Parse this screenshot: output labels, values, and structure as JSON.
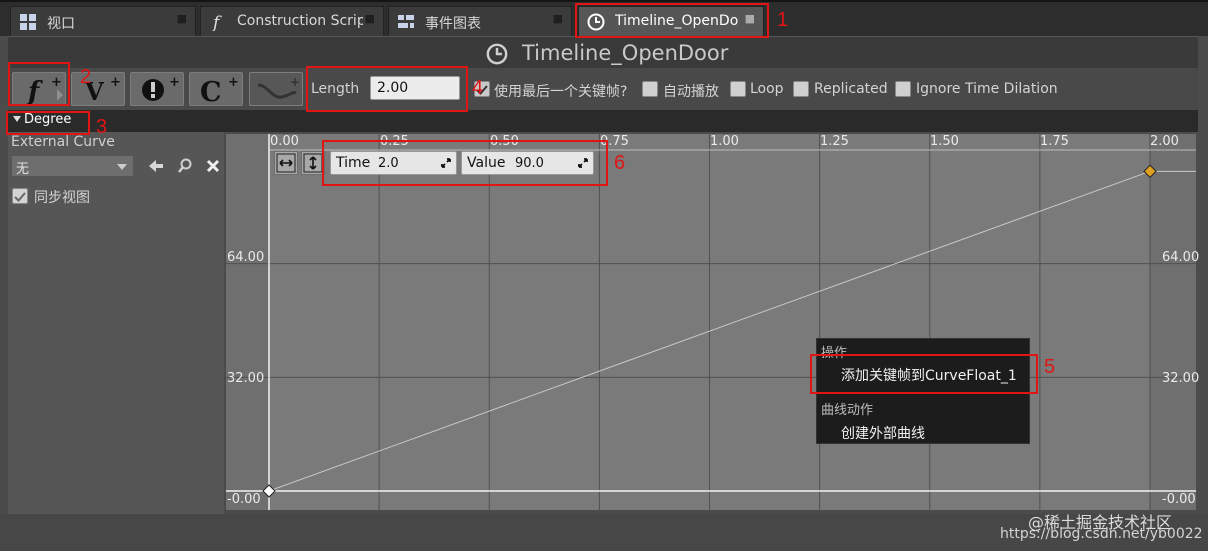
{
  "tabs": [
    {
      "label": "视口",
      "icon": "viewport-grid-icon",
      "active": false
    },
    {
      "label": "Construction Script",
      "icon": "function-icon",
      "active": false
    },
    {
      "label": "事件图表",
      "icon": "event-graph-icon",
      "active": false
    },
    {
      "label": "Timeline_OpenDoor",
      "icon": "clock-icon",
      "active": true
    }
  ],
  "title": "Timeline_OpenDoor",
  "toolbar": {
    "buttons": [
      {
        "name": "add-float-track-button",
        "icon": "float-track-icon"
      },
      {
        "name": "add-vector-track-button",
        "icon": "vector-track-icon"
      },
      {
        "name": "add-event-track-button",
        "icon": "event-track-icon"
      },
      {
        "name": "add-color-track-button",
        "icon": "color-track-icon"
      },
      {
        "name": "add-curve-asset-button",
        "icon": "curve-asset-icon"
      }
    ],
    "length_label": "Length",
    "length_value": "2.00",
    "options": [
      {
        "label": "使用最后一个关键帧?",
        "checked": true
      },
      {
        "label": "自动播放",
        "checked": false
      },
      {
        "label": "Loop",
        "checked": false
      },
      {
        "label": "Replicated",
        "checked": false
      },
      {
        "label": "Ignore Time Dilation",
        "checked": false
      }
    ]
  },
  "track": {
    "name": "Degree",
    "external_curve_label": "External Curve",
    "external_curve_value": "无",
    "sync_view_label": "同步视图",
    "sync_view_checked": true
  },
  "graph": {
    "x_ticks": [
      "0.00",
      "0.25",
      "0.50",
      "0.75",
      "1.00",
      "1.25",
      "1.50",
      "1.75",
      "2.00"
    ],
    "y_labels": [
      "64.00",
      "32.00",
      "-0.00"
    ],
    "key_time_label": "Time",
    "key_time_value": "2.0",
    "key_value_label": "Value",
    "key_value_value": "90.0",
    "keys": [
      {
        "time": 0.0,
        "value": 0.0,
        "selected": false
      },
      {
        "time": 2.0,
        "value": 90.0,
        "selected": true
      }
    ],
    "x_range": [
      0.0,
      2.0
    ],
    "y_range": [
      0.0,
      96.0
    ]
  },
  "context_menu": {
    "section1": "操作",
    "item1": "添加关键帧到CurveFloat_1",
    "section2": "曲线动作",
    "item2": "创建外部曲线"
  },
  "annotations": [
    "1",
    "2",
    "3",
    "4",
    "5",
    "6"
  ],
  "watermark": "@稀土掘金技术社区",
  "watermark_url": "https://blog.csdn.net/yb0022",
  "colors": {
    "annotation": "#e01515",
    "key_selected": "#e0a020"
  }
}
